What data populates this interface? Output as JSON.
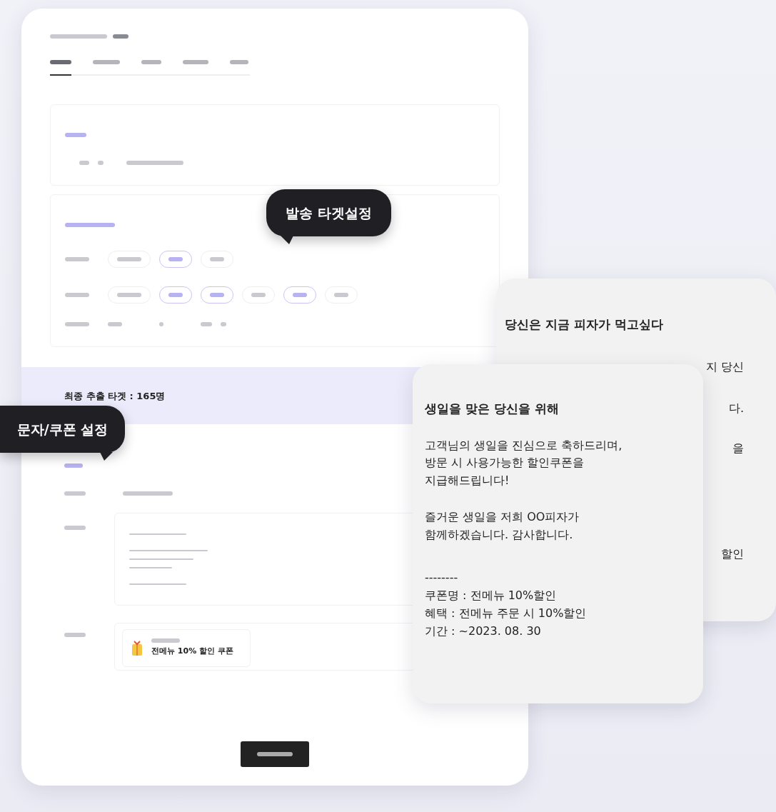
{
  "tabs": [
    {
      "selected": true
    },
    {
      "selected": false
    },
    {
      "selected": false
    },
    {
      "selected": false
    },
    {
      "selected": false
    }
  ],
  "target_filters": [
    {
      "chips": [
        {
          "selected": false
        },
        {
          "selected": true
        },
        {
          "selected": false
        }
      ]
    },
    {
      "chips": [
        {
          "selected": false
        },
        {
          "selected": true
        },
        {
          "selected": true
        },
        {
          "selected": false
        },
        {
          "selected": true
        },
        {
          "selected": false
        }
      ]
    }
  ],
  "summary": {
    "text": "최종 추출 타겟 : 165명"
  },
  "coupon": {
    "name": "전메뉴 10% 할인 쿠폰"
  },
  "callouts": [
    {
      "text": "발송 타겟설정"
    },
    {
      "text": "문자/쿠폰 설정"
    }
  ],
  "message_back": {
    "title": "당신은 지금 피자가 먹고싶다",
    "fragments": [
      "지 당신",
      "다.",
      "을",
      "할인"
    ]
  },
  "message_front": {
    "title": "생일을 맞은 당신을 위해",
    "paragraphs": [
      "고객님의 생일을 진심으로 축하드리며,\n방문 시 사용가능한 할인쿠폰을\n지급해드립니다!",
      "즐거운 생일을 저희 OO피자가\n함께하겠습니다. 감사합니다.",
      "--------\n쿠폰명 : 전메뉴 10%할인\n혜택 : 전메뉴 주문 시 10%할인\n기간 : ~2023. 08. 30"
    ]
  }
}
